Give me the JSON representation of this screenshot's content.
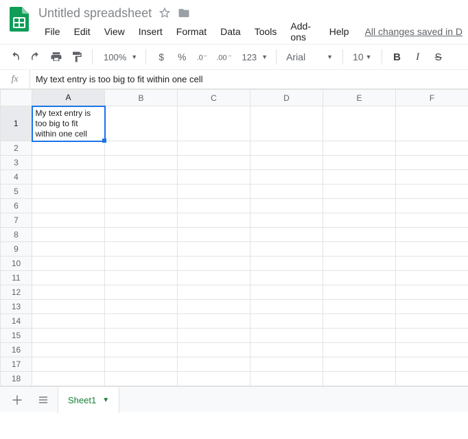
{
  "doc": {
    "title": "Untitled spreadsheet",
    "saved_text": "All changes saved in D"
  },
  "menubar": [
    "File",
    "Edit",
    "View",
    "Insert",
    "Format",
    "Data",
    "Tools",
    "Add-ons",
    "Help"
  ],
  "toolbar": {
    "zoom": "100%",
    "currency": "$",
    "percent": "%",
    "dec_dec": ".0",
    "inc_dec": ".00",
    "more_fmt": "123",
    "font": "Arial",
    "size": "10",
    "bold": "B",
    "italic": "I",
    "strike": "S"
  },
  "formula": {
    "fx_label": "fx",
    "value": "My text entry is too big to fit within one cell"
  },
  "grid": {
    "columns": [
      "A",
      "B",
      "C",
      "D",
      "E",
      "F"
    ],
    "rows": [
      "1",
      "2",
      "3",
      "4",
      "5",
      "6",
      "7",
      "8",
      "9",
      "10",
      "11",
      "12",
      "13",
      "14",
      "15",
      "16",
      "17",
      "18"
    ],
    "selected_cell": "A1",
    "cells": {
      "A1": "My text entry is too big to fit within one cell"
    }
  },
  "sheet_tabs": {
    "active": "Sheet1"
  }
}
